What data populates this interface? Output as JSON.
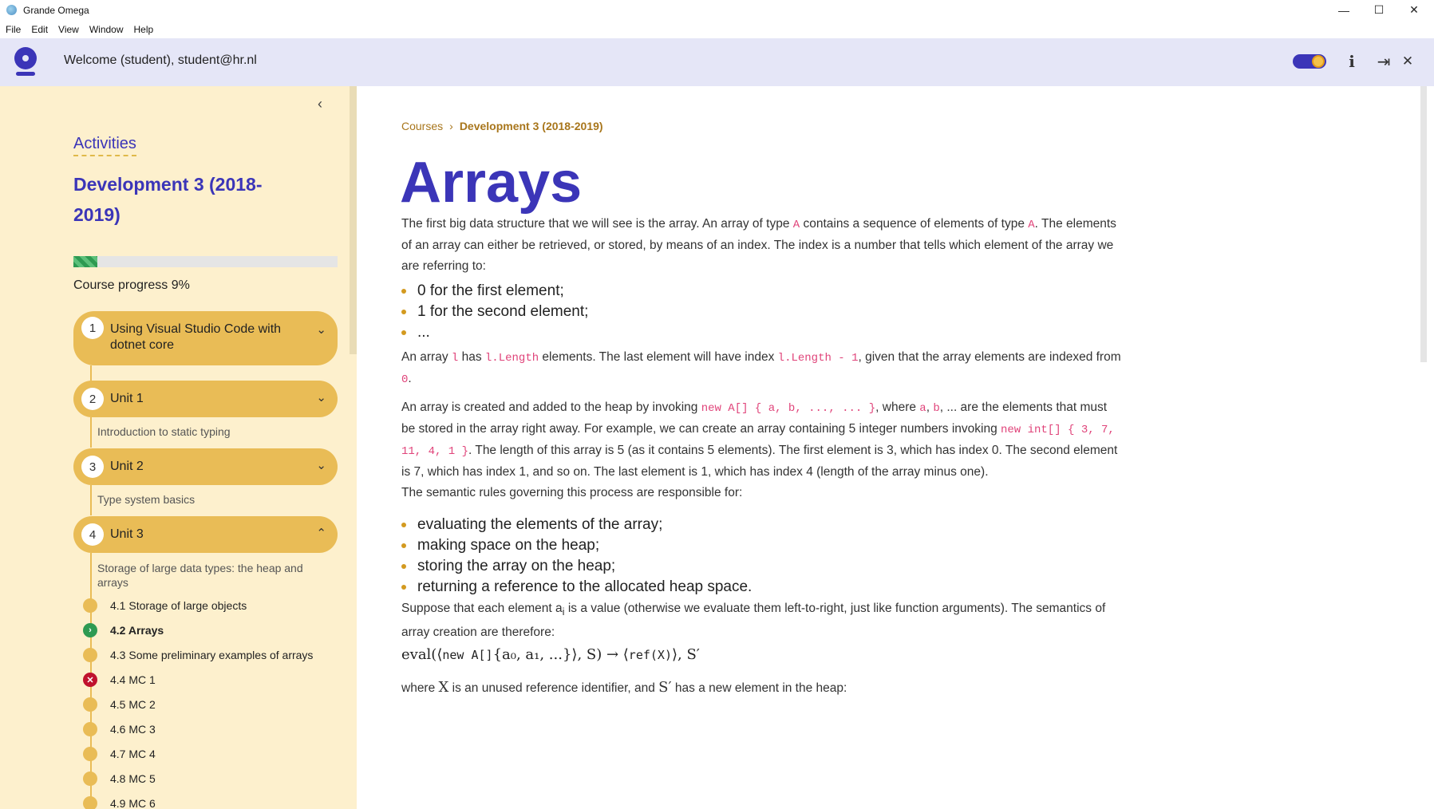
{
  "window": {
    "title": "Grande Omega",
    "minimize": "—",
    "maximize": "☐",
    "close": "✕"
  },
  "menu": [
    "File",
    "Edit",
    "View",
    "Window",
    "Help"
  ],
  "header": {
    "welcome": "Welcome (student), student@hr.nl",
    "info_icon": "i",
    "logout_icon": "⇥",
    "close_icon": "✕"
  },
  "sidebar": {
    "collapse_icon": "‹",
    "activities_label": "Activities",
    "course_title": "Development 3 (2018-2019)",
    "progress_fraction": 0.09,
    "progress_text": "Course progress 9%",
    "units": [
      {
        "num": "1",
        "title": "Using Visual Studio Code with dotnet core",
        "chevron": "⌄",
        "desc": ""
      },
      {
        "num": "2",
        "title": "Unit 1",
        "chevron": "⌄",
        "desc": "Introduction to static typing"
      },
      {
        "num": "3",
        "title": "Unit 2",
        "chevron": "⌄",
        "desc": "Type system basics"
      },
      {
        "num": "4",
        "title": "Unit 3",
        "chevron": "⌃",
        "desc": "Storage of large data types: the heap and arrays"
      }
    ],
    "activities": [
      {
        "label": "4.1  Storage of large objects",
        "status": "none"
      },
      {
        "label": "4.2  Arrays",
        "status": "current"
      },
      {
        "label": "4.3  Some preliminary examples of arrays",
        "status": "none"
      },
      {
        "label": "4.4  MC 1",
        "status": "failed"
      },
      {
        "label": "4.5  MC 2",
        "status": "none"
      },
      {
        "label": "4.6  MC 3",
        "status": "none"
      },
      {
        "label": "4.7  MC 4",
        "status": "none"
      },
      {
        "label": "4.8  MC 5",
        "status": "none"
      },
      {
        "label": "4.9  MC 6",
        "status": "none"
      }
    ]
  },
  "content": {
    "breadcrumb": [
      "Courses",
      "Development 3 (2018-2019)"
    ],
    "title": "Arrays",
    "p1": {
      "t1": "The first big data structure that we will see is the array. An array of type ",
      "c1": "A",
      "t2": " contains a sequence of elements of type ",
      "c2": "A",
      "t3": ". The elements of an array can either be retrieved, or stored, by means of an index. The index is a number that tells which element of the array we are referring to:"
    },
    "list1": [
      "0 for the first element;",
      "1 for the second element;",
      "..."
    ],
    "p2": {
      "t1": "An array ",
      "c1": "l",
      "t2": " has ",
      "c2": "l.Length",
      "t3": " elements. The last element will have index ",
      "c3": "l.Length - 1",
      "t4": ", given that the array elements are indexed from ",
      "c4": "0",
      "t5": "."
    },
    "p3": {
      "t1": "An array is created and added to the heap by invoking ",
      "c1": "new A[] { a, b, ..., ... }",
      "t2": ", where ",
      "c2": "a",
      "t3": ", ",
      "c3": "b",
      "t4": ", ... are the elements that must be stored in the array right away. For example, we can create an array containing 5 integer numbers invoking ",
      "c4": "new int[] { 3, 7, 11, 4, 1 }",
      "t5": ". The length of this array is 5 (as it contains 5 elements). The first element is 3, which has index 0. The second element is 7, which has index 1, and so on. The last element is 1, which has index 4 (length of the array minus one)."
    },
    "p4": "The semantic rules governing this process are responsible for:",
    "list2": [
      "evaluating the elements of the array;",
      "making space on the heap;",
      "storing the array on the heap;",
      "returning a reference to the allocated heap space."
    ],
    "p5": {
      "t1": "Suppose that each element a",
      "sub": "i",
      "t2": " is a value (otherwise we evaluate them left-to-right, just like function arguments). The semantics of array creation are therefore:"
    },
    "formula": {
      "f1": "eval(⟨",
      "m1": "new A[]",
      "f2": "{a₀, a₁, ...}⟩, S) → ⟨",
      "m2": "ref(X)",
      "f3": "⟩, S′"
    },
    "p6": {
      "t1": "where ",
      "m1": "X",
      "t2": " is an unused reference identifier, and ",
      "m2": "S′",
      "t3": " has a new element in the heap:"
    }
  }
}
